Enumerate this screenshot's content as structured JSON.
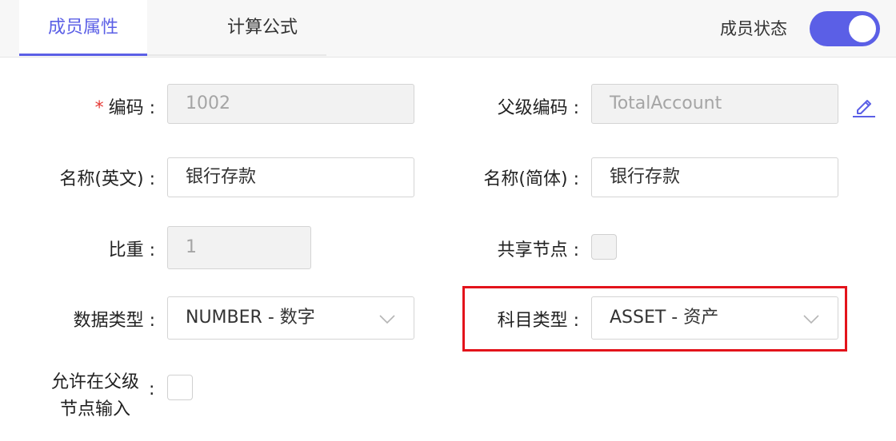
{
  "tabs": {
    "attributes": "成员属性",
    "formula": "计算公式"
  },
  "member_status": {
    "label": "成员状态",
    "enabled": true
  },
  "form": {
    "code": {
      "required_mark": "*",
      "label": "编码",
      "colon": ":",
      "value": "1002"
    },
    "parent_code": {
      "label": "父级编码",
      "colon": ":",
      "value": "TotalAccount"
    },
    "name_en": {
      "label": "名称(英文)",
      "colon": ":",
      "value": "银行存款"
    },
    "name_cn": {
      "label": "名称(简体)",
      "colon": ":",
      "value": "银行存款"
    },
    "weight": {
      "label": "比重",
      "colon": ":",
      "value": "1"
    },
    "shared_node": {
      "label": "共享节点",
      "colon": ":",
      "checked": false
    },
    "data_type": {
      "label": "数据类型",
      "colon": ":",
      "value": "NUMBER - 数字"
    },
    "account_type": {
      "label": "科目类型",
      "colon": ":",
      "value": "ASSET - 资产"
    },
    "allow_parent_input": {
      "label_line1": "允许在父级",
      "label_line2": "节点输入",
      "colon": ":",
      "checked": false
    }
  },
  "colors": {
    "accent": "#5b5fe6",
    "highlight": "#e3131b",
    "required": "#e53935"
  },
  "icons": {
    "edit": "pencil-edit-icon",
    "dropdown": "chevron-down-icon"
  }
}
